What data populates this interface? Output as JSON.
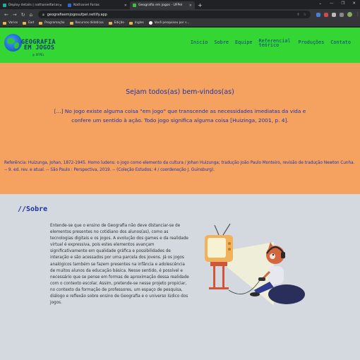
{
  "browser": {
    "tabs": [
      {
        "label": "Deploy details | nathanielfarias",
        "active": false,
        "favicon_color": "#1db0a0"
      },
      {
        "label": "Nathaniel Farias",
        "active": false,
        "favicon_color": "#2b6cd4"
      },
      {
        "label": "Geografia em jogos - UFPel",
        "active": true,
        "favicon_color": "#3ec23e"
      }
    ],
    "new_tab": "+",
    "url": "geografiaemjogosufpel.netlify.app",
    "bookmarks": [
      "Varios",
      "Ead",
      "Programação",
      "Recursos didaticos",
      "Edição",
      "Ingles",
      "Você pesquisou por s..."
    ]
  },
  "site": {
    "logo_line1": "GEOGRAFIA",
    "logo_line2": "EM JOGOS",
    "logo_sub": "@ UFPEL",
    "menu": [
      "Inicio",
      "Sobre",
      "Equipe",
      "Referencial teórico",
      "Produções",
      "Contato"
    ]
  },
  "hero": {
    "title": "Sejam todos(as) bem-vindos(as)",
    "quote": "[...] No jogo existe alguma coisa \"em jogo\" que transcende as necessidades imediatas da vida e confere um sentido à ação. Todo jogo significa alguma coisa [Huizinga, 2001, p. 4].",
    "reference": "Referência: Huizunga, Johan, 1872-1945. Homo ludens: o jogo como elemento da cultura / Johan Huizunga; tradução João Paulo Monteiro, revisão de tradução Newton Cunha. -- 9. ed. rev. e atual. -- São Paulo : Perspectiva, 2019. -- (Coleção Estudos; 4 / coordenação J. Guinsburg)."
  },
  "about": {
    "heading": "//Sobre",
    "text": "Entende-se que o ensino de Geografia não deve distanciar-se de elementos presentes no cotidiano dos alunos(as), como as tecnologias digitais e os jogos. A evolução dos games e da realidade virtual é expressiva, pois estes elementos avançam significativamente em qualidade gráfica e possibilidades de interação e são acessados por uma parcela dos jovens. Já os jogos analógicos também se fazem presentes na infância e adolescência de muitos alunos da educação básica. Nesse sentido, é possível e necessário que se pense em formas de aproximação dessa realidade com o contexto escolar. Assim, pretende-se nesse projeto propiciar, no contexto da formação de professores, um espaço de pesquisa, diálogo e reflexão sobre ensino de Geografia e o universo lúdico dos jogos."
  },
  "colors": {
    "header_green": "#33d633",
    "hero_orange": "#f5a160",
    "about_gray": "#d3d9de",
    "text_blue": "#1f34a8"
  }
}
